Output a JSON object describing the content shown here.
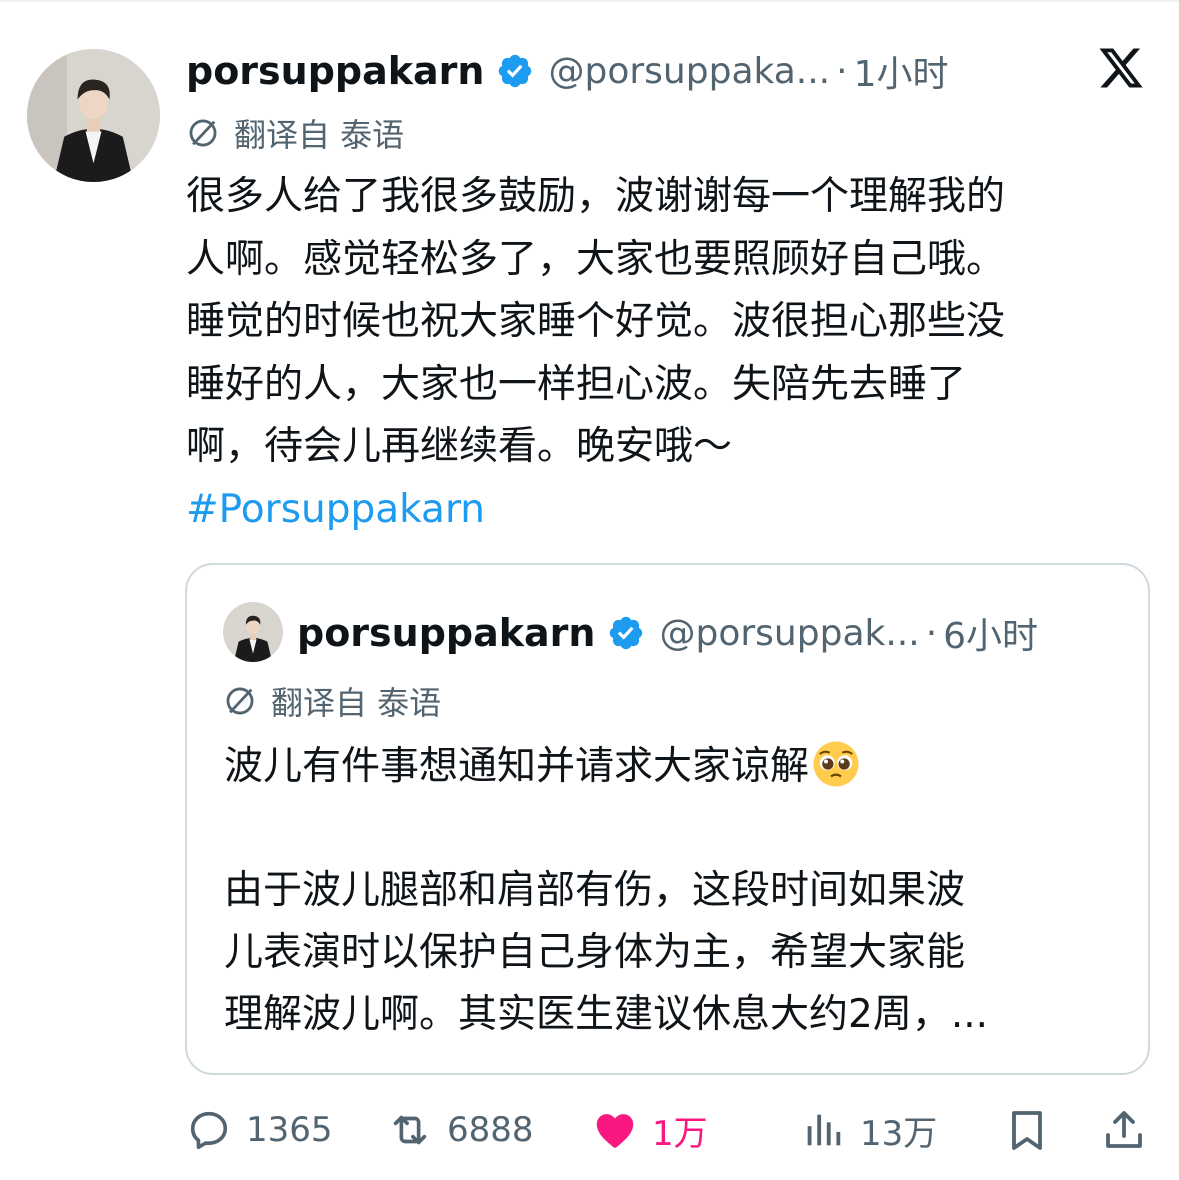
{
  "tweet": {
    "display_name": "porsuppakarn",
    "handle": "@porsuppaka...",
    "separator": "·",
    "time": "1小时",
    "translate_label": "翻译自 泰语",
    "text_lines": [
      "很多人给了我很多鼓励，波谢谢每一个理解我的",
      "人啊。感觉轻松多了，大家也要照顾好自己哦。",
      "睡觉的时候也祝大家睡个好觉。波很担心那些没",
      "睡好的人，大家也一样担心波。失陪先去睡了",
      "啊，待会儿再继续看。晚安哦～"
    ],
    "hashtag": "#Porsuppakarn"
  },
  "quoted": {
    "display_name": "porsuppakarn",
    "handle": "@porsuppak...",
    "separator": "·",
    "time": "6小时",
    "translate_label": "翻译自 泰语",
    "text_lines": [
      "波儿有件事想通知并请求大家谅解",
      "",
      "由于波儿腿部和肩部有伤，这段时间如果波",
      "儿表演时以保护自己身体为主，希望大家能",
      "理解波儿啊。其实医生建议休息大约2周，..."
    ],
    "emoji": "pleading-face-emoji"
  },
  "actions": {
    "replies": "1365",
    "reposts": "6888",
    "likes": "1万",
    "views": "13万"
  },
  "colors": {
    "text": "#0f1419",
    "secondary": "#536471",
    "link": "#1d9bf0",
    "like": "#f91880",
    "verified": "#1d9bf0",
    "border": "#cfd9de"
  }
}
